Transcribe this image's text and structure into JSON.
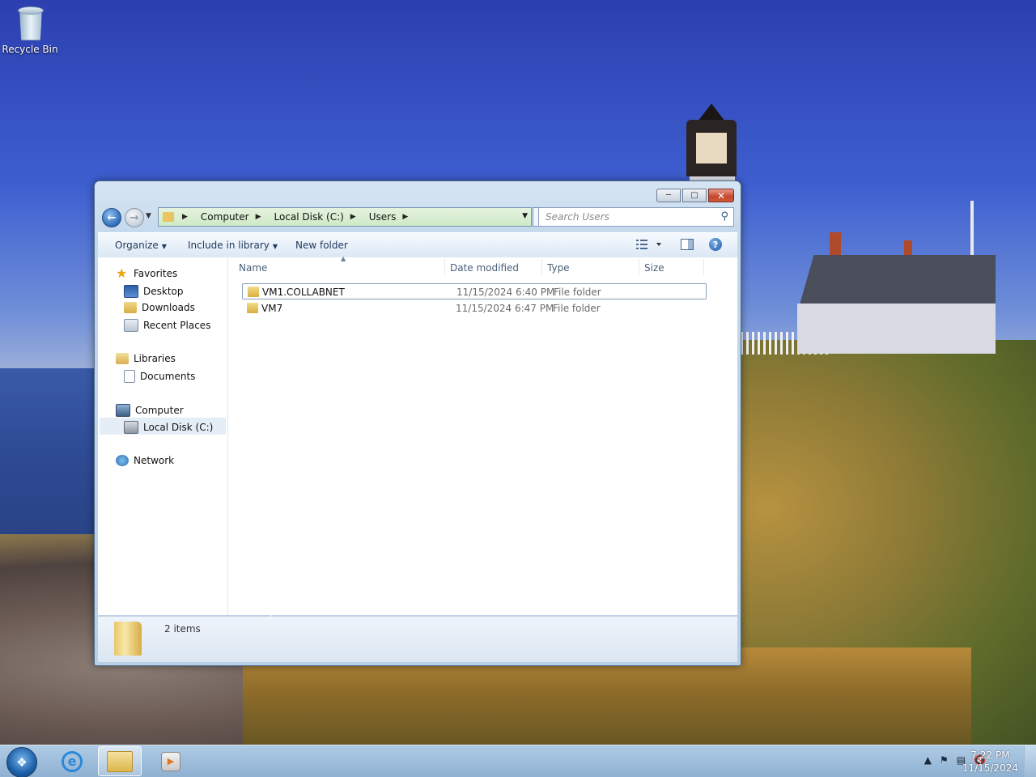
{
  "desktop": {
    "icons": [
      {
        "label": "Recycle Bin",
        "icon": "recycle-bin-icon"
      }
    ]
  },
  "window": {
    "address": {
      "crumbs": [
        "Computer",
        "Local Disk (C:)",
        "Users"
      ]
    },
    "search": {
      "placeholder": "Search Users"
    },
    "toolbar": {
      "organize": "Organize",
      "include_in_library": "Include in library",
      "new_folder": "New folder"
    },
    "nav": {
      "favorites": "Favorites",
      "desktop": "Desktop",
      "downloads": "Downloads",
      "recent_places": "Recent Places",
      "libraries": "Libraries",
      "documents": "Documents",
      "computer": "Computer",
      "local_disk": "Local Disk (C:)",
      "network": "Network"
    },
    "columns": {
      "name": "Name",
      "date_modified": "Date modified",
      "type": "Type",
      "size": "Size"
    },
    "files": [
      {
        "name": "VM1.COLLABNET",
        "date": "11/15/2024 6:40 PM",
        "type": "File folder",
        "selected": true
      },
      {
        "name": "VM7",
        "date": "11/15/2024 6:47 PM",
        "type": "File folder",
        "selected": false
      }
    ],
    "details": {
      "item_count": "2 items"
    }
  },
  "taskbar": {
    "clock_time": "7:22 PM",
    "clock_date": "11/15/2024",
    "pinned": [
      "internet-explorer-icon",
      "windows-explorer-icon",
      "media-player-icon"
    ]
  }
}
